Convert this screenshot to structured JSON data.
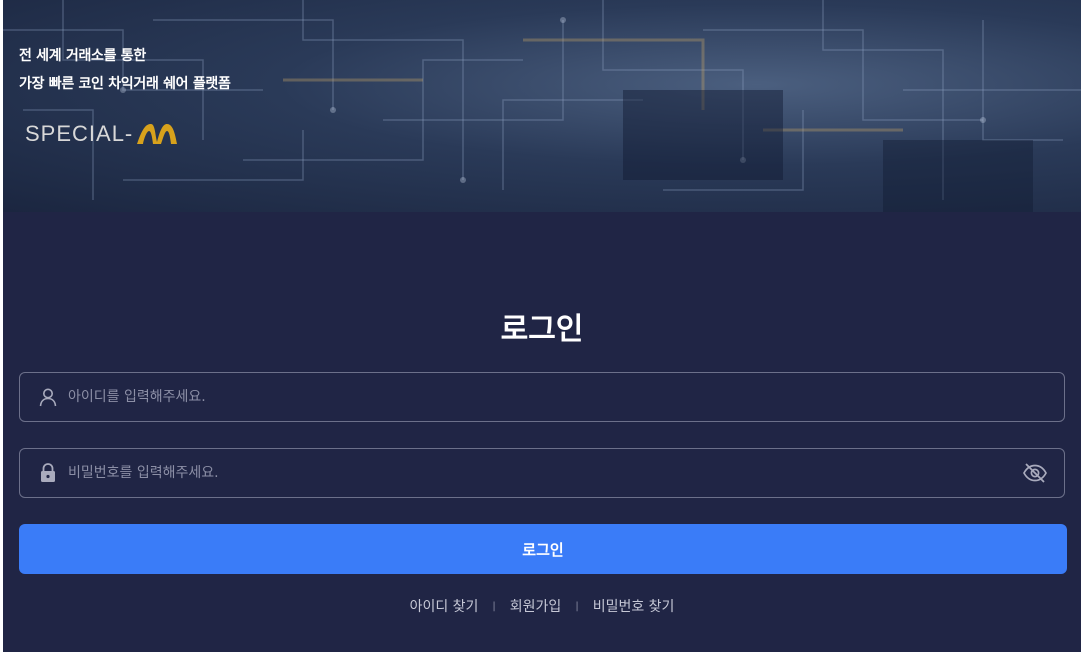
{
  "hero": {
    "line1": "전 세계 거래소를 통한",
    "line2": "가장 빠른 코인 차익거래 쉐어 플랫폼",
    "logo_text": "SPECIAL-",
    "logo_accent": "M"
  },
  "login": {
    "title": "로그인",
    "id_placeholder": "아이디를 입력해주세요.",
    "password_placeholder": "비밀번호를 입력해주세요.",
    "submit_label": "로그인"
  },
  "links": {
    "find_id": "아이디 찾기",
    "signup": "회원가입",
    "find_password": "비밀번호 찾기",
    "separator": "|"
  },
  "icons": {
    "id_field": "user-icon",
    "password_field": "lock-icon",
    "password_toggle": "eye-off-icon"
  },
  "colors": {
    "background": "#202545",
    "primary_button": "#3a7cf8",
    "field_border": "#6c708a",
    "logo_accent": "#d8a21c"
  }
}
